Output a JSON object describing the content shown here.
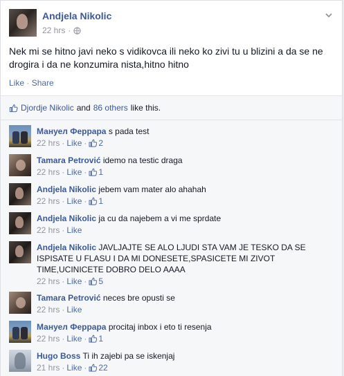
{
  "post": {
    "author": "Andjela Nikolic",
    "time": "22 hrs",
    "separator": "·",
    "text": "Nek mi se hitno javi neko s vidikovca ili neko ko zivi tu u blizini a da se ne drogira i da ne konzumira nista,hitno hitno",
    "like_label": "Like",
    "share_label": "Share",
    "action_separator": "·"
  },
  "likes": {
    "liker": "Djordje Nikolic",
    "and": "and",
    "others": "86 others",
    "suffix": "like this."
  },
  "comments": [
    {
      "name": "Мануел Феррара",
      "text": "s pada test",
      "time": "22 hrs",
      "like": "Like",
      "likes": "2",
      "avatar": "manuel"
    },
    {
      "name": "Tamara Petrović",
      "text": "idemo na testic draga",
      "time": "22 hrs",
      "like": "Like",
      "likes": "1",
      "avatar": "tamara"
    },
    {
      "name": "Andjela Nikolic",
      "text": "jebem vam mater alo ahahah",
      "time": "22 hrs",
      "like": "Like",
      "likes": "1",
      "avatar": "andjela"
    },
    {
      "name": "Andjela Nikolic",
      "text": "ja cu da najebem a vi me sprdate",
      "time": "22 hrs",
      "like": "Like",
      "likes": null,
      "avatar": "andjela"
    },
    {
      "name": "Andjela Nikolic",
      "text": "JAVLJAJTE SE ALO LJUDI STA VAM JE TESKO DA SE ISPISATE U FLASU I DA MI DONESETE,SPASICETE MI ZIVOT TIME,UCINICETE DOBRO DELO AAAA",
      "time": "22 hrs",
      "like": "Like",
      "likes": "5",
      "avatar": "andjela"
    },
    {
      "name": "Tamara Petrović",
      "text": "neces bre opusti se",
      "time": "22 hrs",
      "like": "Like",
      "likes": null,
      "avatar": "tamara"
    },
    {
      "name": "Мануел Феррара",
      "text": "procitaj inbox i eto ti resenja",
      "time": "22 hrs",
      "like": "Like",
      "likes": "1",
      "avatar": "manuel"
    },
    {
      "name": "Hugo Boss",
      "text": "Ti ih zajebi pa se iskenjaj",
      "time": "21 hrs",
      "like": "Like",
      "likes": "22",
      "avatar": "hugo"
    }
  ],
  "meta_separator": "·",
  "icons": {
    "globe": "globe-icon",
    "chevron": "chevron-down-icon",
    "like": "thumbs-up-icon"
  },
  "colors": {
    "link": "#3b5998",
    "action": "#4b6aa8",
    "muted": "#90949c",
    "ufi_bg": "#f6f7f9"
  }
}
